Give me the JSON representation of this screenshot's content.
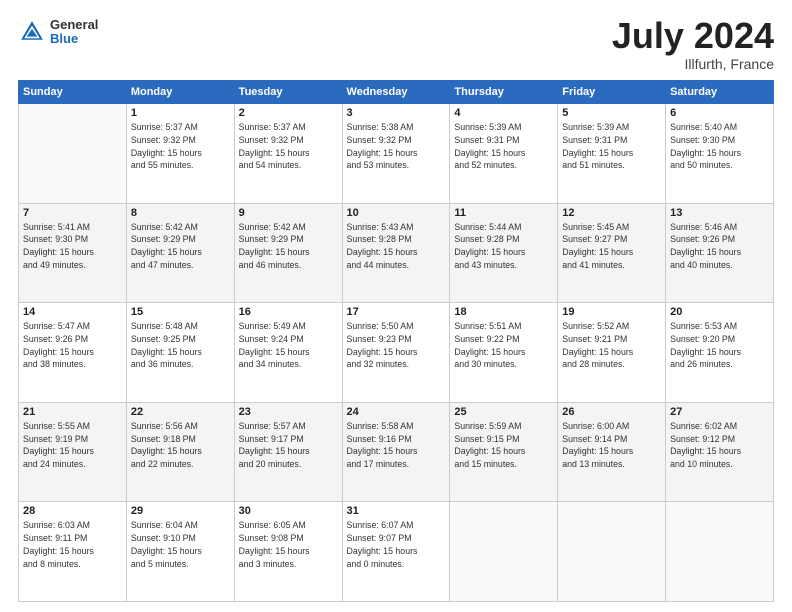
{
  "header": {
    "logo": {
      "general": "General",
      "blue": "Blue"
    },
    "title": "July 2024",
    "location": "Illfurth, France"
  },
  "calendar": {
    "weekdays": [
      "Sunday",
      "Monday",
      "Tuesday",
      "Wednesday",
      "Thursday",
      "Friday",
      "Saturday"
    ],
    "weeks": [
      [
        {
          "day": "",
          "info": ""
        },
        {
          "day": "1",
          "info": "Sunrise: 5:37 AM\nSunset: 9:32 PM\nDaylight: 15 hours\nand 55 minutes."
        },
        {
          "day": "2",
          "info": "Sunrise: 5:37 AM\nSunset: 9:32 PM\nDaylight: 15 hours\nand 54 minutes."
        },
        {
          "day": "3",
          "info": "Sunrise: 5:38 AM\nSunset: 9:32 PM\nDaylight: 15 hours\nand 53 minutes."
        },
        {
          "day": "4",
          "info": "Sunrise: 5:39 AM\nSunset: 9:31 PM\nDaylight: 15 hours\nand 52 minutes."
        },
        {
          "day": "5",
          "info": "Sunrise: 5:39 AM\nSunset: 9:31 PM\nDaylight: 15 hours\nand 51 minutes."
        },
        {
          "day": "6",
          "info": "Sunrise: 5:40 AM\nSunset: 9:30 PM\nDaylight: 15 hours\nand 50 minutes."
        }
      ],
      [
        {
          "day": "7",
          "info": "Sunrise: 5:41 AM\nSunset: 9:30 PM\nDaylight: 15 hours\nand 49 minutes."
        },
        {
          "day": "8",
          "info": "Sunrise: 5:42 AM\nSunset: 9:29 PM\nDaylight: 15 hours\nand 47 minutes."
        },
        {
          "day": "9",
          "info": "Sunrise: 5:42 AM\nSunset: 9:29 PM\nDaylight: 15 hours\nand 46 minutes."
        },
        {
          "day": "10",
          "info": "Sunrise: 5:43 AM\nSunset: 9:28 PM\nDaylight: 15 hours\nand 44 minutes."
        },
        {
          "day": "11",
          "info": "Sunrise: 5:44 AM\nSunset: 9:28 PM\nDaylight: 15 hours\nand 43 minutes."
        },
        {
          "day": "12",
          "info": "Sunrise: 5:45 AM\nSunset: 9:27 PM\nDaylight: 15 hours\nand 41 minutes."
        },
        {
          "day": "13",
          "info": "Sunrise: 5:46 AM\nSunset: 9:26 PM\nDaylight: 15 hours\nand 40 minutes."
        }
      ],
      [
        {
          "day": "14",
          "info": "Sunrise: 5:47 AM\nSunset: 9:26 PM\nDaylight: 15 hours\nand 38 minutes."
        },
        {
          "day": "15",
          "info": "Sunrise: 5:48 AM\nSunset: 9:25 PM\nDaylight: 15 hours\nand 36 minutes."
        },
        {
          "day": "16",
          "info": "Sunrise: 5:49 AM\nSunset: 9:24 PM\nDaylight: 15 hours\nand 34 minutes."
        },
        {
          "day": "17",
          "info": "Sunrise: 5:50 AM\nSunset: 9:23 PM\nDaylight: 15 hours\nand 32 minutes."
        },
        {
          "day": "18",
          "info": "Sunrise: 5:51 AM\nSunset: 9:22 PM\nDaylight: 15 hours\nand 30 minutes."
        },
        {
          "day": "19",
          "info": "Sunrise: 5:52 AM\nSunset: 9:21 PM\nDaylight: 15 hours\nand 28 minutes."
        },
        {
          "day": "20",
          "info": "Sunrise: 5:53 AM\nSunset: 9:20 PM\nDaylight: 15 hours\nand 26 minutes."
        }
      ],
      [
        {
          "day": "21",
          "info": "Sunrise: 5:55 AM\nSunset: 9:19 PM\nDaylight: 15 hours\nand 24 minutes."
        },
        {
          "day": "22",
          "info": "Sunrise: 5:56 AM\nSunset: 9:18 PM\nDaylight: 15 hours\nand 22 minutes."
        },
        {
          "day": "23",
          "info": "Sunrise: 5:57 AM\nSunset: 9:17 PM\nDaylight: 15 hours\nand 20 minutes."
        },
        {
          "day": "24",
          "info": "Sunrise: 5:58 AM\nSunset: 9:16 PM\nDaylight: 15 hours\nand 17 minutes."
        },
        {
          "day": "25",
          "info": "Sunrise: 5:59 AM\nSunset: 9:15 PM\nDaylight: 15 hours\nand 15 minutes."
        },
        {
          "day": "26",
          "info": "Sunrise: 6:00 AM\nSunset: 9:14 PM\nDaylight: 15 hours\nand 13 minutes."
        },
        {
          "day": "27",
          "info": "Sunrise: 6:02 AM\nSunset: 9:12 PM\nDaylight: 15 hours\nand 10 minutes."
        }
      ],
      [
        {
          "day": "28",
          "info": "Sunrise: 6:03 AM\nSunset: 9:11 PM\nDaylight: 15 hours\nand 8 minutes."
        },
        {
          "day": "29",
          "info": "Sunrise: 6:04 AM\nSunset: 9:10 PM\nDaylight: 15 hours\nand 5 minutes."
        },
        {
          "day": "30",
          "info": "Sunrise: 6:05 AM\nSunset: 9:08 PM\nDaylight: 15 hours\nand 3 minutes."
        },
        {
          "day": "31",
          "info": "Sunrise: 6:07 AM\nSunset: 9:07 PM\nDaylight: 15 hours\nand 0 minutes."
        },
        {
          "day": "",
          "info": ""
        },
        {
          "day": "",
          "info": ""
        },
        {
          "day": "",
          "info": ""
        }
      ]
    ]
  }
}
